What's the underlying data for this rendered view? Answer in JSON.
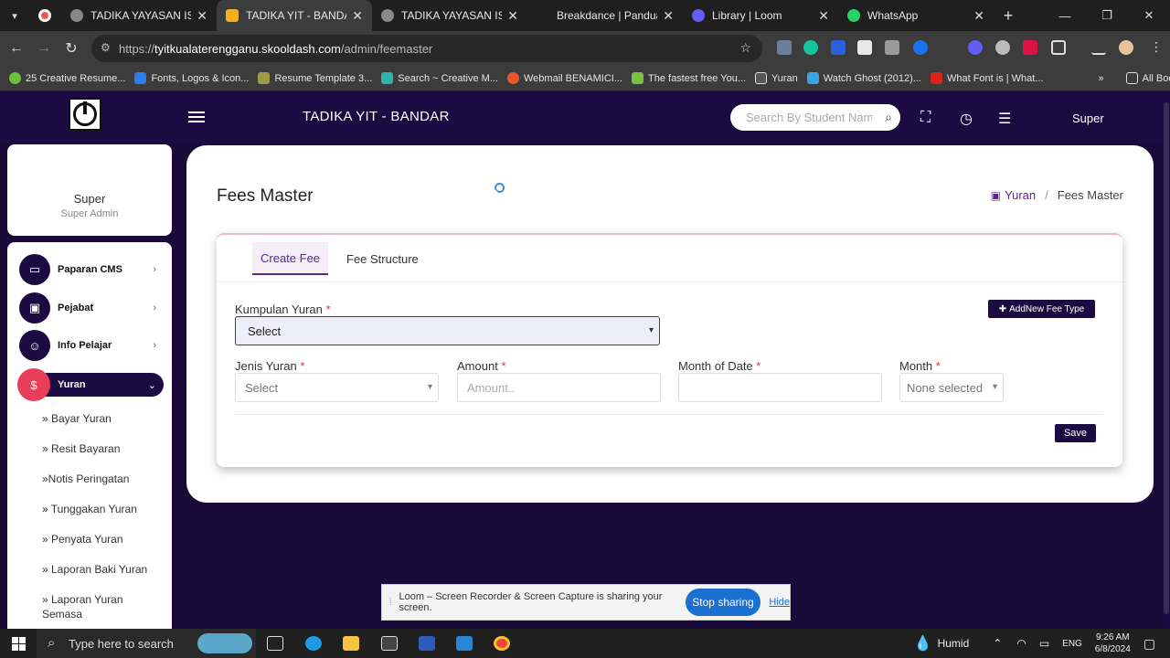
{
  "browser": {
    "tabs": [
      {
        "title": "TADIKA YAYASAN ISLAM",
        "color": "#888"
      },
      {
        "title": "TADIKA YIT - BANDAR",
        "color": "#f2b01e",
        "active": true
      },
      {
        "title": "TADIKA YAYASAN ISLAM",
        "color": "#888"
      },
      {
        "title": "Breakdance | Panduan Gu",
        "color": "#222"
      },
      {
        "title": "Library | Loom",
        "color": "#625df5"
      },
      {
        "title": "WhatsApp",
        "color": "#25d366"
      }
    ],
    "url_prefix": "https://",
    "url_host": "tyitkualaterengganu.skooldash.com",
    "url_path": "/admin/feemaster",
    "bookmarks": [
      "25 Creative Resume...",
      "Fonts, Logos & Icon...",
      "Resume Template 3...",
      "Search ~ Creative M...",
      "Webmail BENAMICI...",
      "The fastest free You...",
      "Yuran",
      "Watch Ghost (2012)...",
      "What Font is | What..."
    ],
    "all_bookmarks": "All Bookmarks"
  },
  "header": {
    "app_title": "TADIKA YIT - BANDAR",
    "search_placeholder": "Search By Student Name",
    "user": "Super"
  },
  "profile": {
    "name": "Super",
    "role": "Super Admin"
  },
  "sidebar": {
    "items": [
      {
        "label": "Paparan CMS",
        "icon": "monitor-icon"
      },
      {
        "label": "Pejabat",
        "icon": "briefcase-icon"
      },
      {
        "label": "Info Pelajar",
        "icon": "student-icon"
      },
      {
        "label": "Yuran",
        "icon": "hand-money-icon",
        "active": true
      }
    ],
    "sub_items": [
      "» Bayar Yuran",
      "» Resit Bayaran",
      "»Notis Peringatan",
      "» Tunggakan Yuran",
      "» Penyata Yuran",
      "» Laporan Baki Yuran",
      "» Laporan Yuran Semasa"
    ]
  },
  "page": {
    "title": "Fees Master",
    "breadcrumb": [
      "Yuran",
      "/",
      "Fees Master"
    ],
    "tabs": [
      "Create Fee",
      "Fee Structure"
    ],
    "form": {
      "kumpulan_label": "Kumpulan Yuran",
      "kumpulan_value": "Select",
      "add_button": "AddNew Fee Type",
      "jenis_label": "Jenis Yuran",
      "jenis_value": "Select",
      "amount_label": "Amount",
      "amount_placeholder": "Amount..",
      "month_of_date_label": "Month of Date",
      "month_label": "Month",
      "month_value": "None selected",
      "required_mark": "*",
      "save_button": "Save"
    }
  },
  "loom": {
    "message": "Loom – Screen Recorder & Screen Capture is sharing your screen.",
    "stop_button": "Stop sharing",
    "hide_link": "Hide"
  },
  "taskbar": {
    "search_placeholder": "Type here to search",
    "weather": "Humid",
    "lang": "ENG",
    "time": "9:26 AM",
    "date": "6/8/2024"
  }
}
